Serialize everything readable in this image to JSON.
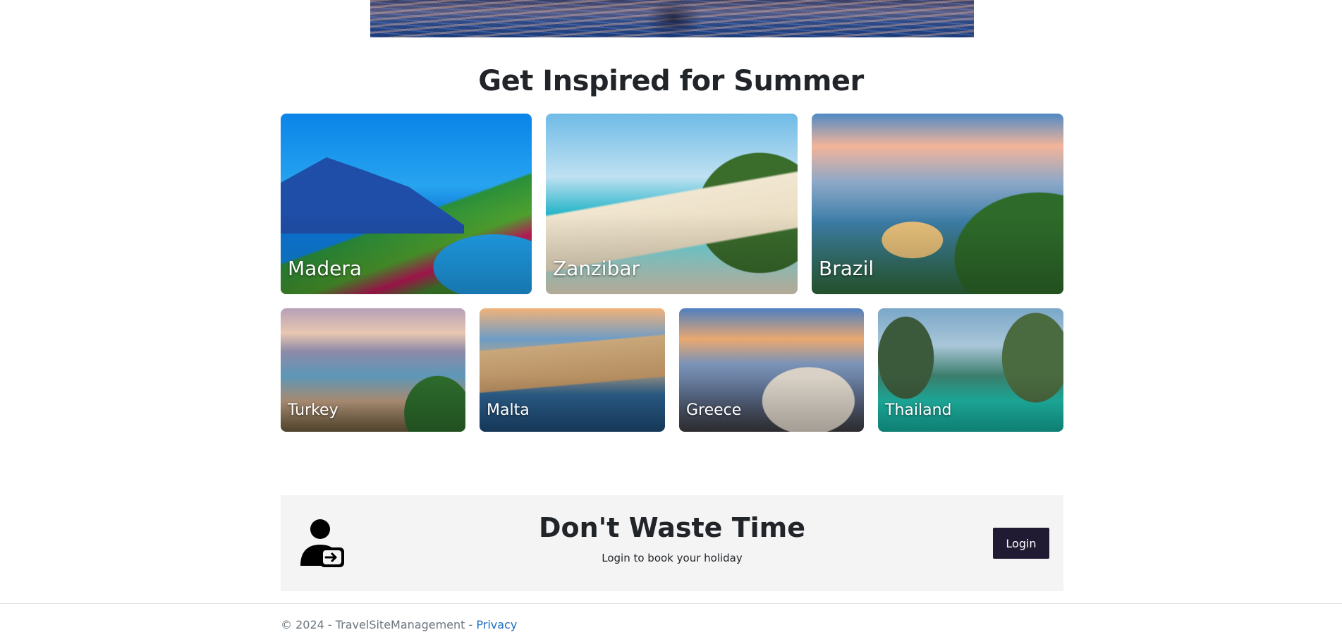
{
  "section": {
    "title": "Get Inspired for Summer"
  },
  "destinations_top": [
    {
      "name": "Madera"
    },
    {
      "name": "Zanzibar"
    },
    {
      "name": "Brazil"
    }
  ],
  "destinations_bottom": [
    {
      "name": "Turkey"
    },
    {
      "name": "Malta"
    },
    {
      "name": "Greece"
    },
    {
      "name": "Thailand"
    }
  ],
  "cta": {
    "icon": "user-login-icon",
    "title": "Don't Waste Time",
    "subtitle": "Login to book your holiday",
    "button_label": "Login"
  },
  "footer": {
    "copyright": "© 2024 - TravelSiteManagement - ",
    "privacy_link": "Privacy"
  },
  "colors": {
    "button_bg": "#211a33",
    "cta_bg": "#f4f4f5",
    "link": "#1b6ec2"
  }
}
